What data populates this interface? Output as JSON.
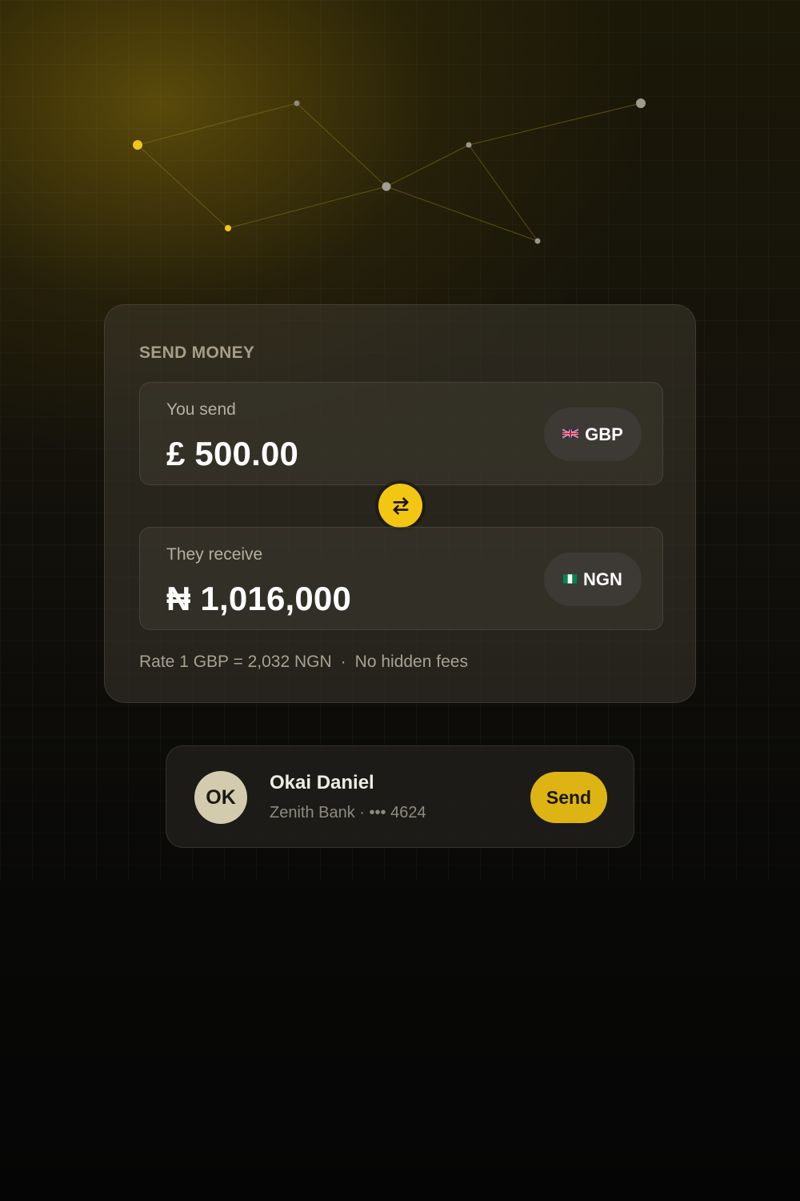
{
  "send_card": {
    "title": "SEND MONEY",
    "send": {
      "label": "You send",
      "amount": "£ 500.00",
      "currency_code": "GBP",
      "flag_icon": "uk-flag-icon"
    },
    "receive": {
      "label": "They receive",
      "amount": "₦ 1,016,000",
      "currency_code": "NGN",
      "flag_icon": "nigeria-flag-icon"
    },
    "swap_icon": "swap-arrows-icon",
    "rate": "Rate 1 GBP = 2,032 NGN",
    "rate_separator": "·",
    "fees_note": "No hidden fees"
  },
  "recipient": {
    "initials": "OK",
    "name": "Okai Daniel",
    "bank": "Zenith Bank",
    "separator": "·",
    "account_mask": "••• 4624",
    "send_label": "Send"
  },
  "colors": {
    "accent": "#F3C613",
    "send_button": "#DEB414",
    "avatar": "#D3CBAD",
    "background": "#070706"
  }
}
